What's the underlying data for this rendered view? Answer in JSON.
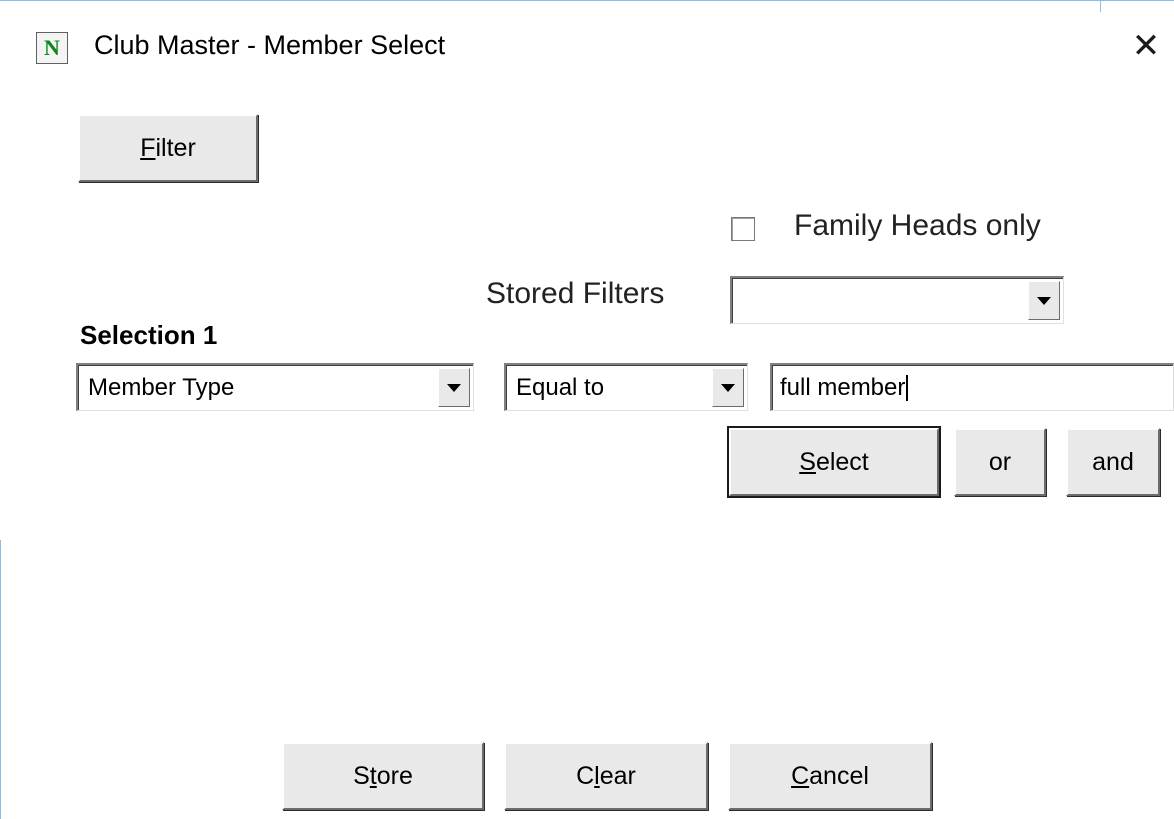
{
  "window": {
    "title": "Club Master - Member Select",
    "icon_letter": "N",
    "icon_name": "app-n-icon",
    "close_glyph": "✕"
  },
  "toolbar": {
    "filter_label_prefix": "",
    "filter_label_mnemonic": "F",
    "filter_label_rest": "ilter"
  },
  "options": {
    "family_heads_label": "Family Heads only",
    "family_heads_checked": false,
    "stored_filters_label": "Stored Filters",
    "stored_filters_value": ""
  },
  "selection": {
    "heading": "Selection 1",
    "field_value": "Member Type",
    "operator_value": "Equal to",
    "criteria_value": "full member"
  },
  "actions": {
    "select_mnemonic": "S",
    "select_rest": "elect",
    "or_label": "or",
    "and_label": "and"
  },
  "footer": {
    "store_prefix": "S",
    "store_mnemonic": "t",
    "store_rest": "ore",
    "clear_prefix": "C",
    "clear_mnemonic": "l",
    "clear_rest": "ear",
    "cancel_mnemonic": "C",
    "cancel_rest": "ancel"
  },
  "colors": {
    "window_border": "#8cbde6",
    "button_face": "#e9e9e9",
    "icon_letter": "#0a8a1a"
  }
}
